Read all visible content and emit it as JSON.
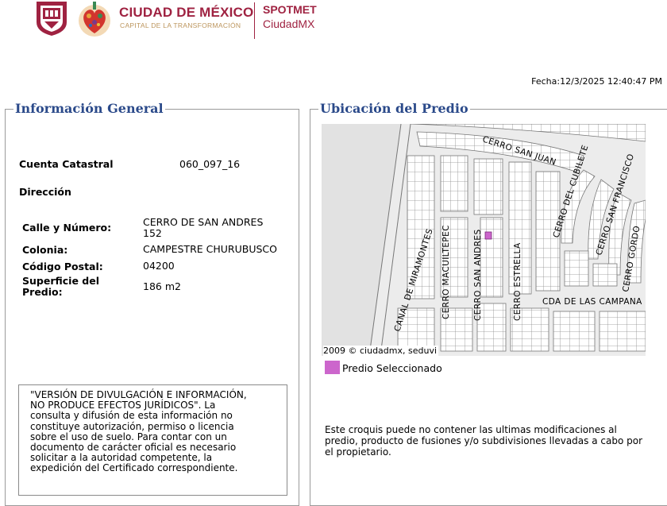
{
  "header": {
    "org_title": "CIUDAD DE MÉXICO",
    "org_subtitle": "CAPITAL DE LA TRANSFORMACIÓN",
    "app_title": "SPOTMET",
    "app_subtitle": "CiudadMX"
  },
  "date_text": "Fecha:12/3/2025 12:40:47 PM",
  "general": {
    "legend": "Información General",
    "cuenta_label": "Cuenta Catastral",
    "cuenta_value": "060_097_16",
    "direccion_label": "Dirección",
    "calle_label": "Calle y Número:",
    "calle_value_line1": "CERRO DE SAN ANDRES",
    "calle_value_line2": "152",
    "colonia_label": "Colonia:",
    "colonia_value": "CAMPESTRE CHURUBUSCO",
    "cp_label": "Código Postal:",
    "cp_value": "04200",
    "superficie_label_line1": "Superficie del",
    "superficie_label_line2": "Predio:",
    "superficie_value": "186 m2",
    "notice_lines": [
      "\"VERSIÓN DE DIVULGACIÓN E INFORMACIÓN,",
      "NO PRODUCE EFECTOS JURÍDICOS\". La",
      "consulta y difusión de esta información no",
      "constituye autorización, permiso o licencia",
      "sobre el uso de suelo. Para contar con un",
      "documento de carácter oficial es necesario",
      "solicitar a la autoridad competente, la",
      "expedición del Certificado correspondiente."
    ]
  },
  "location": {
    "legend": "Ubicación del Predio",
    "map_credit": "2009 © ciudadmx, seduvi",
    "selected_legend": "Predio Seleccionado",
    "selected_color": "#cc66cc",
    "disclaimer": "Este croquis puede no contener las ultimas modificaciones al predio, producto de fusiones y/o subdivisiones llevadas a cabo por el propietario.",
    "streets": {
      "cerro_san_juan": "CERRO SAN JUAN",
      "canal_miramontes": "CANAL DE MIRAMONTES",
      "cerro_macuiltepec": "CERRO MACUILTEPEC",
      "cerro_san_andres": "CERRO SAN ANDRES",
      "cerro_estrella": "CERRO ESTRELLA",
      "cerro_cubilete": "CERRO DEL CUBILETE",
      "cerro_san_francisco": "CERRO SAN FRANCISCO",
      "cerro_gordo": "CERRO GORDO",
      "cda_campana": "CDA DE LAS CAMPANA"
    }
  }
}
